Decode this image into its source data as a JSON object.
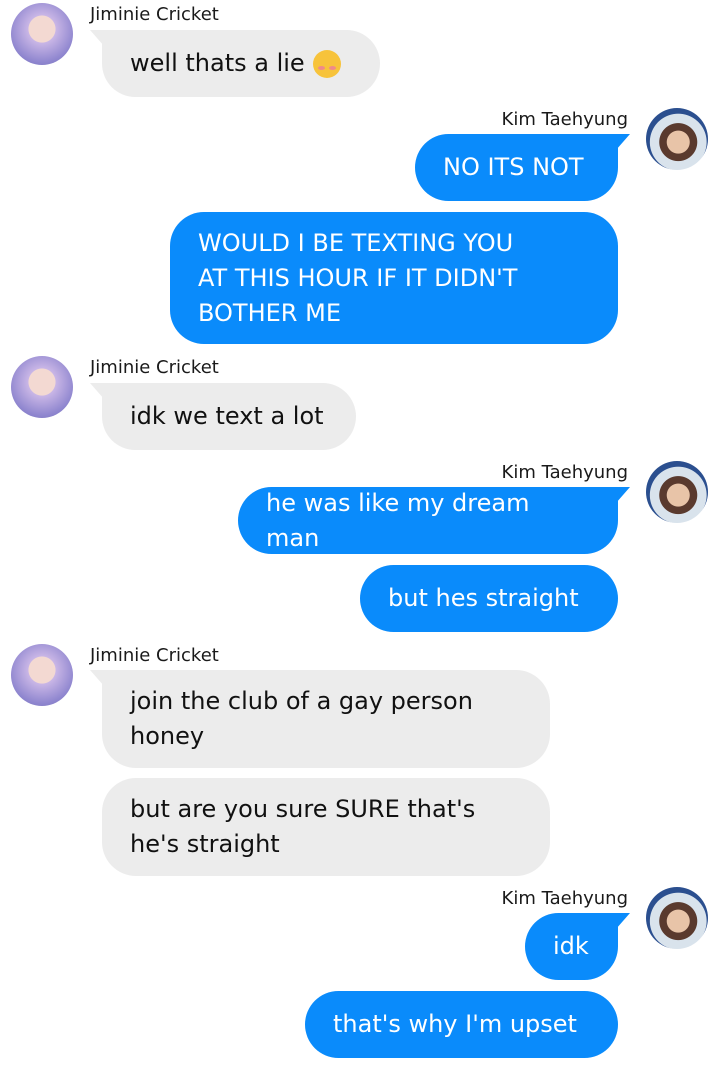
{
  "contacts": {
    "left_name": "Jiminie Cricket",
    "right_name": "Kim Taehyung"
  },
  "messages": [
    {
      "sender": "Jiminie Cricket",
      "text": "well thats a lie",
      "emoji": "kissing-face-emoji"
    },
    {
      "sender": "Kim Taehyung",
      "text": "NO ITS NOT"
    },
    {
      "sender": "Kim Taehyung",
      "text": "WOULD I BE TEXTING YOU\nAT THIS HOUR IF IT DIDN'T\nBOTHER ME"
    },
    {
      "sender": "Jiminie Cricket",
      "text": "idk we text a lot"
    },
    {
      "sender": "Kim Taehyung",
      "text": "he was like my dream man"
    },
    {
      "sender": "Kim Taehyung",
      "text": "but hes straight"
    },
    {
      "sender": "Jiminie Cricket",
      "text": "join the club of a gay person\nhoney"
    },
    {
      "sender": "Jiminie Cricket",
      "text": "but are you sure SURE that's\nhe's straight"
    },
    {
      "sender": "Kim Taehyung",
      "text": "idk"
    },
    {
      "sender": "Kim Taehyung",
      "text": "that's why I'm upset"
    }
  ],
  "colors": {
    "incoming_bubble": "#ececec",
    "outgoing_bubble": "#0a8bfb",
    "outgoing_text": "#ffffff",
    "incoming_text": "#111111"
  }
}
